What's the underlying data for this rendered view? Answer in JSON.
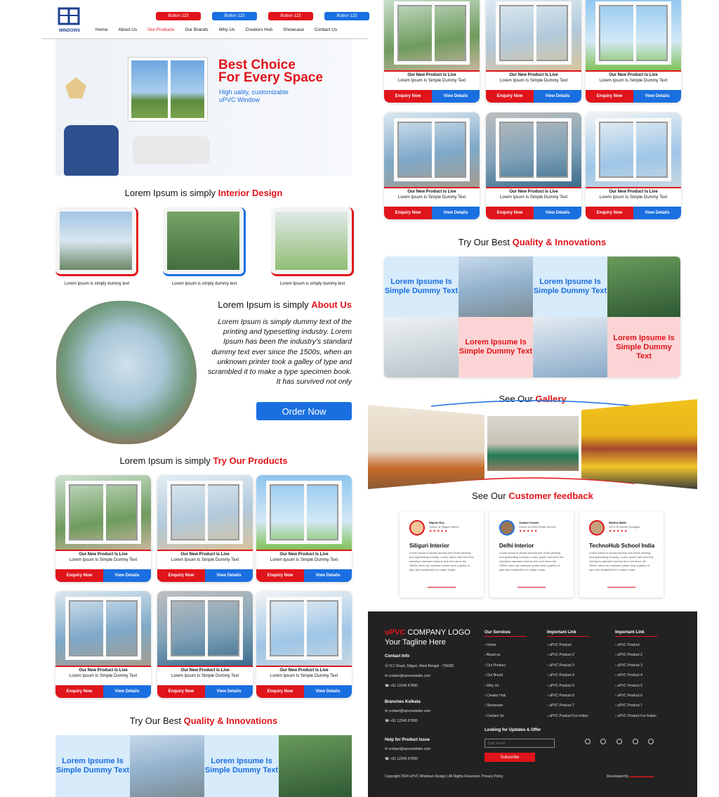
{
  "header": {
    "logo_text": "WINDOWS",
    "buttons": [
      "Button 123",
      "Button 123",
      "Button 123",
      "Button 123"
    ],
    "nav": [
      "Home",
      "About Us",
      "Our Products",
      "Our Brands",
      "Why Us",
      "Creators Hub",
      "Showcase",
      "Contact Us"
    ]
  },
  "hero": {
    "line1": "Best Choice",
    "line2": "For Every Space",
    "sub1": "High uality, customizable",
    "sub2": "uPVC Window"
  },
  "interior": {
    "title_a": "Lorem Ipsum is simply ",
    "title_b": "Interior Design",
    "captions": [
      "Lorem Ipsum is simply dummy text",
      "Lorem Ipsum is simply dummy text",
      "Lorem Ipsum is simply dummy text"
    ]
  },
  "about": {
    "title_a": "Lorem Ipsum is simply ",
    "title_b": "About Us",
    "body": "Lorem Ipsum is simply dummy text of the printing and typesetting industry. Lorem Ipsum has been the industry's standard dummy text ever since the 1500s, when an unknown printer took a galley of type and scrambled it to make a type specimen book. It has survived not only",
    "order": "Order Now"
  },
  "products": {
    "title_a": "Lorem Ipsum is simply ",
    "title_b": "Try Our Products",
    "card_title": "Our New Product Is Live",
    "card_sub": "Lorem Ipsum Is Simple Dummy Text",
    "enquiry": "Enquiry Now",
    "details": "View Details"
  },
  "quality": {
    "title_a": "Try Our Best ",
    "title_b": "Quality & Innovations",
    "cell": "Lorem Ipsume Is Simple Dummy Text"
  },
  "gallery": {
    "title_a": "See Our ",
    "title_b": "Gallery"
  },
  "feedback": {
    "title_a": "See Our ",
    "title_b": "Customer feedback",
    "items": [
      {
        "name": "Rajesh Roy",
        "role": "Owner of Siliguri Interior",
        "stars": "★★★★★",
        "title": "Siliguri Interior"
      },
      {
        "name": "Joniper Kumar",
        "role": "Owner of Delhi Public School",
        "stars": "★★★★★",
        "title": "Delhi Interior"
      },
      {
        "name": "Mahfuz Malik",
        "role": "CEO Of Interior Designer",
        "stars": "★★★★★",
        "title": "TechnoHub School India"
      }
    ],
    "body": "Lorem Ipsum is simply dummy text of the printing and typesetting industry. Lorem Ipsum has been the industry's standard dummy text ever since the 1500s, when an unknown printer took a galley of type and scrambled it to make a type."
  },
  "footer": {
    "logo_a": "uPVC",
    "logo_b": " COMPANY LOGO",
    "tagline": "Your Tagline Here",
    "contact_h": "Contact Info",
    "address": "H.C Road, Siliguri, West Bengal - 734265",
    "email": "contact@upvcwebsite.com",
    "phone": "+91 12345 67890",
    "branch_h": "Branches Kolkata",
    "help_h": "Help for Product Issue",
    "services_h": "Our Services",
    "services": [
      "Home",
      "About us",
      "Our Product",
      "Our Brand",
      "Why Us",
      "Creator Hub",
      "Showcase",
      "Contact Us"
    ],
    "imp1_h": "Important Link",
    "imp1": [
      "uPVC Product",
      "uPVC Product 2",
      "uPVC Product 3",
      "uPVC Product 4",
      "uPVC Product 5",
      "uPVC Product 6",
      "uPVC Product 7",
      "uPVC Product For Indian"
    ],
    "imp2_h": "Important Link",
    "imp2": [
      "uPVC Product",
      "uPVC Product 2",
      "uPVC Product 3",
      "uPVC Product 4",
      "uPVC Product 5",
      "uPVC Product 6",
      "uPVC Product 7",
      "uPVC Product For Indian"
    ],
    "updates_h": "Looking for Updates & Offer",
    "email_placeholder": "Type Email",
    "subscribe": "Subscribe",
    "copyright": "Copyright 2024 uPVC Windows Design | All Rights Reserved. Privacy Policy",
    "developed": "Developed By"
  },
  "colors": {
    "red": "#e0141b",
    "blue": "#1a6fe0",
    "footer_bg": "#222222"
  }
}
